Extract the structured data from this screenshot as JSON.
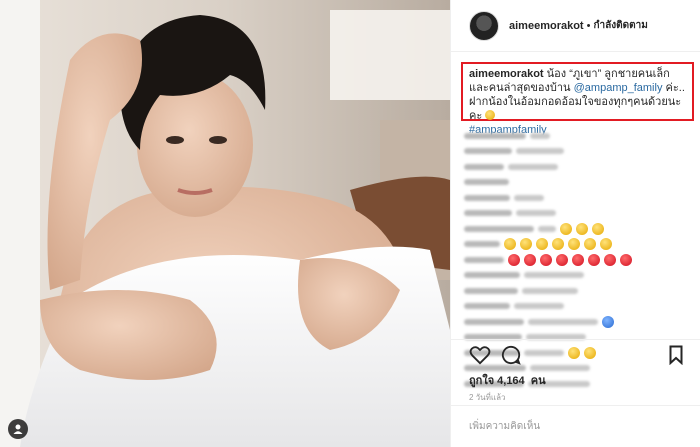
{
  "post": {
    "author": {
      "username": "aimeemorakot",
      "separator": "•",
      "follow_label": "กำลังติดตาม"
    },
    "caption": {
      "username": "aimeemorakot",
      "text_before_mention": "น้อง “ภูเขา” ลูกชายคนเล็กและคนล่าสุดของบ้าน",
      "mention": "@ampamp_family",
      "text_after_mention": "ค่ะ.. ฝากน้องในอ้อมกอดอ้อมใจของทุกๆคนด้วยนะคะ",
      "hashtag": "#ampampfamily"
    },
    "likes": {
      "label": "ถูกใจ",
      "count": "4,164",
      "unit": "คน"
    },
    "time_ago": "2 วันที่แล้ว",
    "comment_placeholder": "เพิ่มความคิดเห็น"
  },
  "comments_visual": [
    {
      "bar1": 62,
      "bar2": 20,
      "emojis": []
    },
    {
      "bar1": 48,
      "bar2": 48,
      "emojis": []
    },
    {
      "bar1": 40,
      "bar2": 50,
      "emojis": []
    },
    {
      "bar1": 45,
      "bar2": 0,
      "emojis": []
    },
    {
      "bar1": 46,
      "bar2": 30,
      "emojis": []
    },
    {
      "bar1": 48,
      "bar2": 40,
      "emojis": []
    },
    {
      "bar1": 70,
      "bar2": 18,
      "emojis": [
        "yellow",
        "yellow",
        "yellow"
      ]
    },
    {
      "bar1": 36,
      "bar2": 0,
      "emojis": [
        "yellow",
        "yellow",
        "yellow",
        "yellow",
        "yellow",
        "yellow",
        "yellow"
      ]
    },
    {
      "bar1": 40,
      "bar2": 0,
      "emojis": [
        "red",
        "red",
        "red",
        "red",
        "red",
        "red",
        "red",
        "red"
      ]
    },
    {
      "bar1": 56,
      "bar2": 60,
      "emojis": []
    },
    {
      "bar1": 54,
      "bar2": 56,
      "emojis": []
    },
    {
      "bar1": 46,
      "bar2": 50,
      "emojis": []
    },
    {
      "bar1": 60,
      "bar2": 70,
      "emojis": [
        "blue"
      ]
    },
    {
      "bar1": 58,
      "bar2": 60,
      "emojis": []
    },
    {
      "bar1": 56,
      "bar2": 40,
      "emojis": [
        "yellow",
        "yellow"
      ]
    },
    {
      "bar1": 62,
      "bar2": 60,
      "emojis": []
    },
    {
      "bar1": 60,
      "bar2": 62,
      "emojis": []
    }
  ],
  "icons": {
    "like": "heart-icon",
    "comment": "comment-bubble-icon",
    "save": "bookmark-icon",
    "user_tag": "user-tag-icon",
    "caption_emoji": "smile-emoji-icon"
  },
  "colors": {
    "highlight_border": "#e21b23",
    "link": "#2b6aa1",
    "text": "#262626",
    "muted": "#999999"
  }
}
